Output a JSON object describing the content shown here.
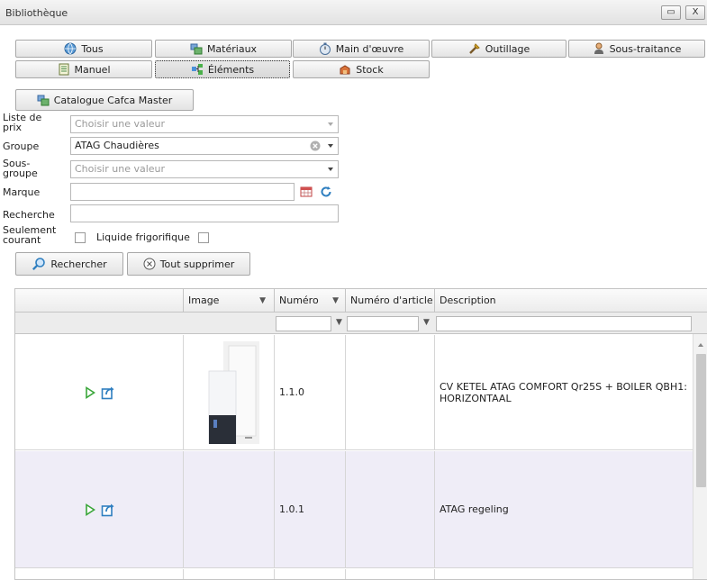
{
  "window": {
    "title": "Bibliothèque",
    "restore_label": "▭",
    "close_label": "X"
  },
  "tabs": [
    {
      "label": "Tous",
      "icon": "globe-icon"
    },
    {
      "label": "Matériaux",
      "icon": "materials-icon"
    },
    {
      "label": "Main d'œuvre",
      "icon": "stopwatch-icon"
    },
    {
      "label": "Outillage",
      "icon": "tools-icon"
    },
    {
      "label": "Sous-traitance",
      "icon": "person-icon"
    },
    {
      "label": "Manuel",
      "icon": "document-icon"
    },
    {
      "label": "Éléments",
      "icon": "elements-icon",
      "active": true
    },
    {
      "label": "Stock",
      "icon": "stock-icon"
    },
    {
      "label": "Catalogue Cafca Master",
      "icon": "catalogue-icon"
    }
  ],
  "form": {
    "price_list": {
      "label_line1": "Liste de",
      "label_line2": "prix",
      "placeholder": "Choisir une valeur"
    },
    "group": {
      "label": "Groupe",
      "value": "ATAG Chaudières"
    },
    "subgroup": {
      "label_line1": "Sous-",
      "label_line2": "groupe",
      "placeholder": "Choisir une valeur"
    },
    "brand": {
      "label": "Marque",
      "value": ""
    },
    "search": {
      "label": "Recherche",
      "value": ""
    },
    "only_current": {
      "label_line1": "Seulement",
      "label_line2": "courant",
      "checked": false
    },
    "refrigerant": {
      "label": "Liquide frigorifique",
      "checked": false
    },
    "search_button": "Rechercher",
    "clear_button": "Tout supprimer"
  },
  "grid": {
    "columns": [
      "",
      "Image",
      "Numéro",
      "Numéro d'article",
      "Description"
    ],
    "rows": [
      {
        "numero": "1.1.0",
        "article": "",
        "description_line1": "CV KETEL ATAG COMFORT Qr25S + BOILER QBH1:",
        "description_line2": "HORIZONTAAL",
        "has_image": true
      },
      {
        "numero": "1.0.1",
        "article": "",
        "description_line1": "ATAG regeling",
        "description_line2": "",
        "has_image": false
      }
    ]
  },
  "colors": {
    "row_alt": "#efedf7",
    "accent": "#2f7fc0",
    "play_green": "#3aa63a"
  }
}
